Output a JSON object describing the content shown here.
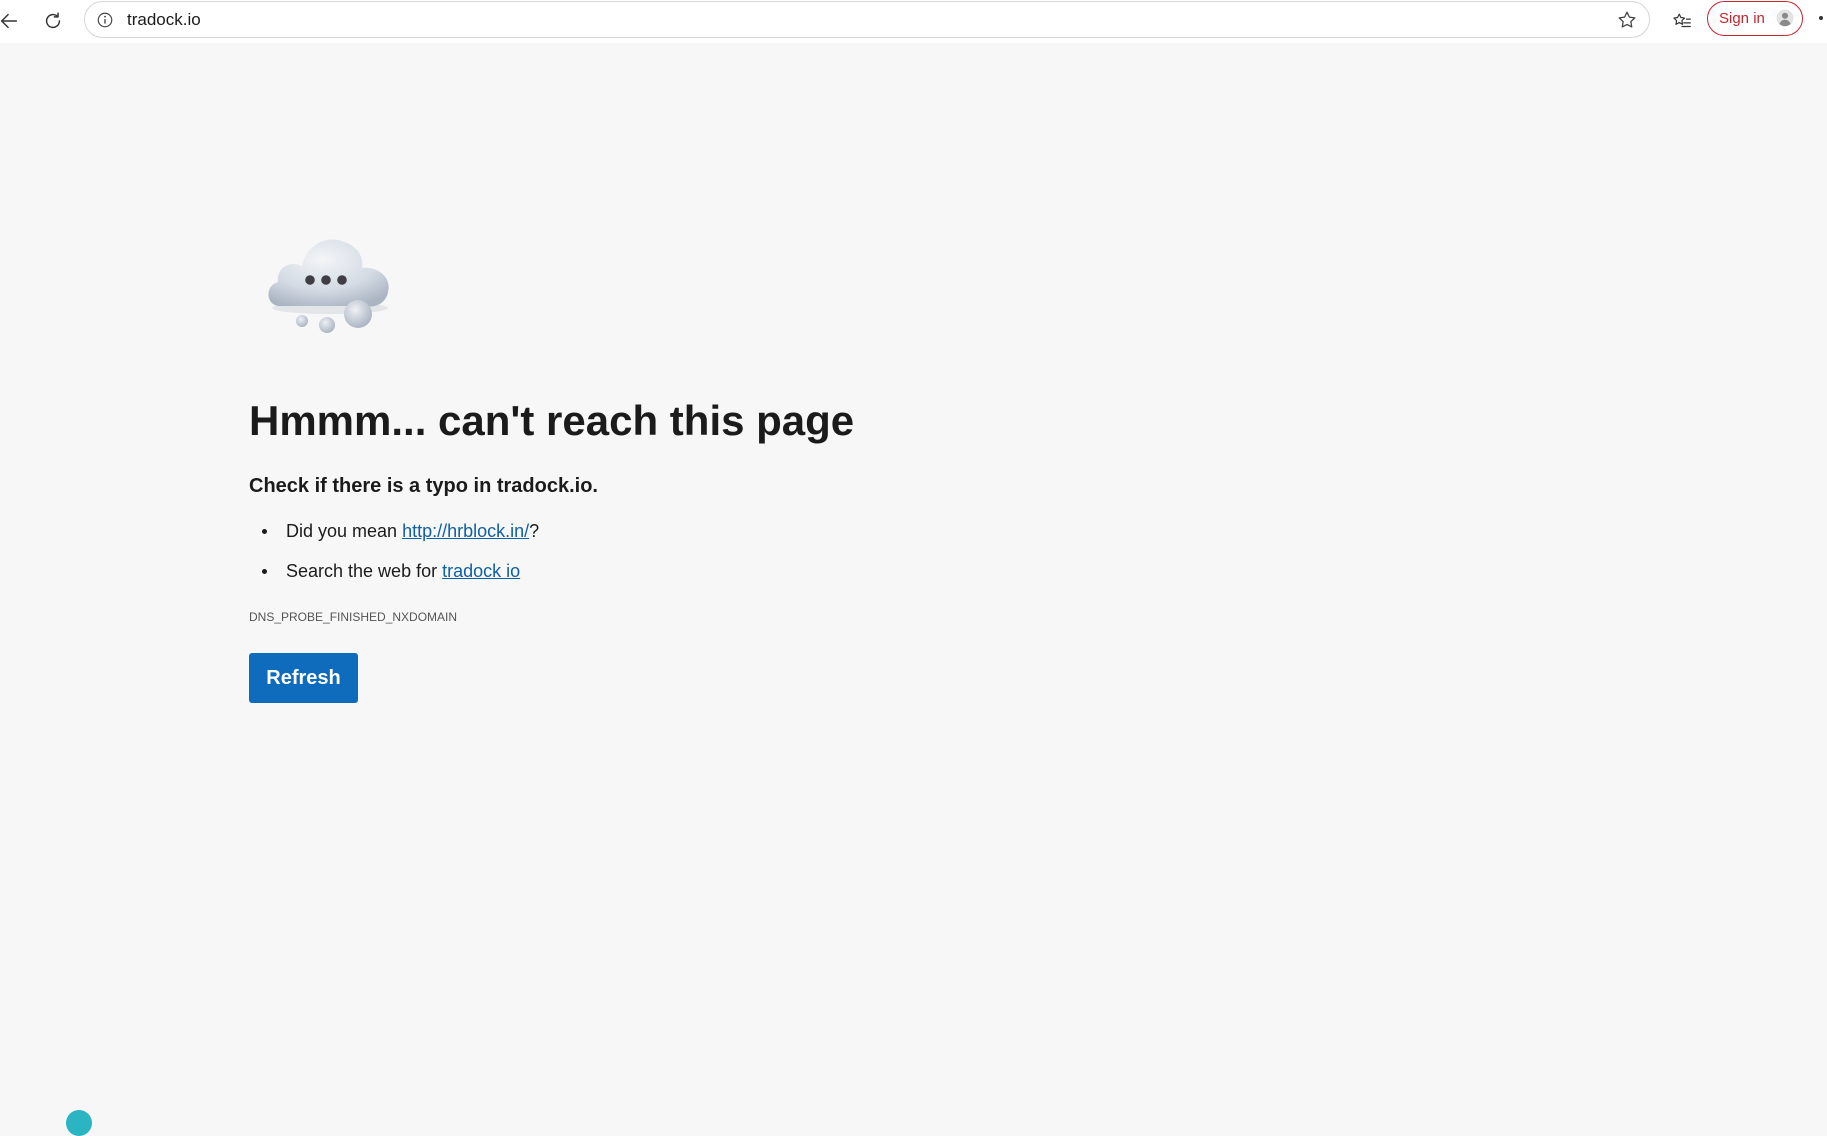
{
  "browser": {
    "url": "tradock.io",
    "signin_label": "Sign in",
    "icons": {
      "back": "back-arrow-icon",
      "reload": "reload-icon",
      "info": "info-icon",
      "favorite": "star-icon",
      "favorites_list": "favorites-icon",
      "profile": "person-icon",
      "more": "more-icon"
    },
    "accent_color": "#c4262e"
  },
  "error_page": {
    "illustration": "cloud-icon",
    "title": "Hmmm... can't reach this page",
    "subtitle": "Check if there is a typo in tradock.io.",
    "suggestions": [
      {
        "prefix": "Did you mean ",
        "link": "http://hrblock.in/",
        "suffix": "?"
      },
      {
        "prefix": "Search the web for ",
        "link": "tradock io",
        "suffix": ""
      }
    ],
    "error_code": "DNS_PROBE_FINISHED_NXDOMAIN",
    "refresh_label": "Refresh",
    "button_color": "#0f6cbd",
    "link_color": "#0f5fa6"
  }
}
